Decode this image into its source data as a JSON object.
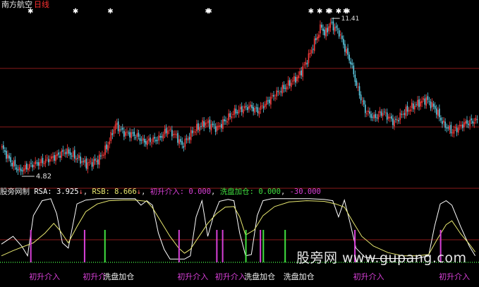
{
  "title": {
    "name": "南方航空",
    "period": "日线"
  },
  "indicator_header": {
    "name": "股旁网制",
    "rsa_label": "RSA:",
    "rsa_value": "3.925",
    "rsb_label": "RSB:",
    "rsb_value": "8.666",
    "chusheng_label": "初升介入:",
    "chusheng_value": "0.000",
    "xipan_label": "洗盘加仓:",
    "xipan_value": "0.000",
    "extra_value": "-30.000"
  },
  "watermark": "股旁网 www.gupang.com",
  "colors": {
    "background": "#000000",
    "up": "#ff3c3c",
    "down": "#5fd0e8",
    "rsa": "#ffffff",
    "rsb": "#e8e870",
    "chusheng": "#d840d8",
    "xipan": "#40e040",
    "grid": "#8a1a1a",
    "name": "#e8e8e8"
  },
  "chart_data": [
    {
      "type": "candlestick",
      "title": "南方航空 日线",
      "price_range": [
        4.3,
        12.0
      ],
      "low_annotation": "4.82",
      "high_annotation": "11.41",
      "close_trajectory": [
        {
          "x": 0,
          "close": 5.9
        },
        {
          "x": 6,
          "close": 5.3
        },
        {
          "x": 12,
          "close": 4.9
        },
        {
          "x": 20,
          "close": 5.15
        },
        {
          "x": 28,
          "close": 5.3
        },
        {
          "x": 36,
          "close": 5.5
        },
        {
          "x": 44,
          "close": 5.75
        },
        {
          "x": 52,
          "close": 5.45
        },
        {
          "x": 58,
          "close": 5.2
        },
        {
          "x": 66,
          "close": 5.35
        },
        {
          "x": 72,
          "close": 5.9
        },
        {
          "x": 78,
          "close": 6.9
        },
        {
          "x": 84,
          "close": 6.55
        },
        {
          "x": 92,
          "close": 6.45
        },
        {
          "x": 98,
          "close": 6.15
        },
        {
          "x": 108,
          "close": 6.3
        },
        {
          "x": 114,
          "close": 6.7
        },
        {
          "x": 120,
          "close": 6.4
        },
        {
          "x": 124,
          "close": 6.0
        },
        {
          "x": 132,
          "close": 6.65
        },
        {
          "x": 140,
          "close": 7.0
        },
        {
          "x": 148,
          "close": 6.75
        },
        {
          "x": 160,
          "close": 7.45
        },
        {
          "x": 170,
          "close": 7.7
        },
        {
          "x": 176,
          "close": 7.5
        },
        {
          "x": 186,
          "close": 8.1
        },
        {
          "x": 196,
          "close": 8.6
        },
        {
          "x": 204,
          "close": 9.0
        },
        {
          "x": 210,
          "close": 9.7
        },
        {
          "x": 216,
          "close": 10.6
        },
        {
          "x": 220,
          "close": 11.2
        },
        {
          "x": 222,
          "close": 10.8
        },
        {
          "x": 226,
          "close": 11.3
        },
        {
          "x": 232,
          "close": 10.9
        },
        {
          "x": 236,
          "close": 10.2
        },
        {
          "x": 240,
          "close": 9.6
        },
        {
          "x": 244,
          "close": 8.6
        },
        {
          "x": 250,
          "close": 7.5
        },
        {
          "x": 256,
          "close": 7.2
        },
        {
          "x": 262,
          "close": 7.45
        },
        {
          "x": 270,
          "close": 7.0
        },
        {
          "x": 276,
          "close": 7.4
        },
        {
          "x": 284,
          "close": 7.75
        },
        {
          "x": 292,
          "close": 8.0
        },
        {
          "x": 298,
          "close": 7.6
        },
        {
          "x": 304,
          "close": 6.9
        },
        {
          "x": 310,
          "close": 6.6
        },
        {
          "x": 318,
          "close": 6.95
        },
        {
          "x": 327,
          "close": 7.1
        }
      ],
      "signal_markers": [
        20,
        51,
        75,
        142,
        143,
        213,
        219,
        225,
        226,
        232,
        237,
        238
      ]
    },
    {
      "type": "line",
      "title": "股旁网制",
      "ylim": [
        0,
        100
      ],
      "series": [
        {
          "name": "RSA",
          "points": [
            [
              0,
              28
            ],
            [
              8,
              40
            ],
            [
              14,
              25
            ],
            [
              18,
              10
            ],
            [
              22,
              72
            ],
            [
              28,
              95
            ],
            [
              34,
              98
            ],
            [
              38,
              75
            ],
            [
              42,
              30
            ],
            [
              46,
              22
            ],
            [
              52,
              90
            ],
            [
              58,
              96
            ],
            [
              66,
              98
            ],
            [
              74,
              98
            ],
            [
              84,
              98
            ],
            [
              92,
              98
            ],
            [
              96,
              88
            ],
            [
              100,
              95
            ],
            [
              104,
              88
            ],
            [
              108,
              45
            ],
            [
              112,
              20
            ],
            [
              116,
              5
            ],
            [
              120,
              5
            ],
            [
              126,
              5
            ],
            [
              130,
              10
            ],
            [
              134,
              70
            ],
            [
              138,
              95
            ],
            [
              142,
              40
            ],
            [
              146,
              72
            ],
            [
              150,
              94
            ],
            [
              156,
              97
            ],
            [
              160,
              95
            ],
            [
              164,
              45
            ],
            [
              168,
              10
            ],
            [
              172,
              12
            ],
            [
              176,
              72
            ],
            [
              180,
              95
            ],
            [
              186,
              98
            ],
            [
              194,
              98
            ],
            [
              202,
              98
            ],
            [
              212,
              98
            ],
            [
              222,
              97
            ],
            [
              228,
              95
            ],
            [
              232,
              70
            ],
            [
              236,
              96
            ],
            [
              240,
              60
            ],
            [
              244,
              22
            ],
            [
              250,
              8
            ],
            [
              256,
              6
            ],
            [
              266,
              6
            ],
            [
              276,
              6
            ],
            [
              286,
              6
            ],
            [
              294,
              10
            ],
            [
              298,
              55
            ],
            [
              302,
              90
            ],
            [
              306,
              95
            ],
            [
              310,
              88
            ],
            [
              316,
              55
            ],
            [
              322,
              25
            ],
            [
              326,
              10
            ]
          ]
        },
        {
          "name": "RSB",
          "points": [
            [
              0,
              10
            ],
            [
              8,
              18
            ],
            [
              16,
              25
            ],
            [
              22,
              30
            ],
            [
              30,
              45
            ],
            [
              36,
              60
            ],
            [
              40,
              50
            ],
            [
              46,
              30
            ],
            [
              52,
              55
            ],
            [
              58,
              78
            ],
            [
              66,
              90
            ],
            [
              74,
              95
            ],
            [
              84,
              96
            ],
            [
              92,
              96
            ],
            [
              100,
              94
            ],
            [
              104,
              84
            ],
            [
              110,
              62
            ],
            [
              116,
              40
            ],
            [
              122,
              22
            ],
            [
              126,
              14
            ],
            [
              130,
              20
            ],
            [
              136,
              40
            ],
            [
              142,
              60
            ],
            [
              148,
              75
            ],
            [
              154,
              85
            ],
            [
              160,
              86
            ],
            [
              164,
              70
            ],
            [
              168,
              42
            ],
            [
              174,
              50
            ],
            [
              180,
              72
            ],
            [
              188,
              86
            ],
            [
              198,
              93
            ],
            [
              210,
              95
            ],
            [
              222,
              94
            ],
            [
              230,
              90
            ],
            [
              236,
              85
            ],
            [
              242,
              62
            ],
            [
              248,
              40
            ],
            [
              256,
              25
            ],
            [
              266,
              15
            ],
            [
              276,
              10
            ],
            [
              286,
              10
            ],
            [
              294,
              12
            ],
            [
              300,
              36
            ],
            [
              306,
              58
            ],
            [
              310,
              64
            ],
            [
              316,
              44
            ],
            [
              322,
              28
            ],
            [
              326,
              16
            ]
          ]
        }
      ],
      "chusheng_signals": [
        20,
        57,
        122,
        148,
        152,
        178,
        243,
        302,
        332
      ],
      "xipan_signals": [
        71,
        168,
        180,
        195
      ],
      "bottom_labels": [
        {
          "text": "初升介入",
          "color": "#d840d8",
          "x": 20
        },
        {
          "text": "初升介",
          "color": "#d840d8",
          "x": 57
        },
        {
          "text": "洗盘加仓",
          "color": "#f0f0f0",
          "x": 71
        },
        {
          "text": "初升介入",
          "color": "#d840d8",
          "x": 122
        },
        {
          "text": "初升介入",
          "color": "#d840d8",
          "x": 148
        },
        {
          "text": "洗盘加仓",
          "color": "#f0f0f0",
          "x": 168
        },
        {
          "text": "洗盘加仓",
          "color": "#f0f0f0",
          "x": 195
        },
        {
          "text": "初升介入",
          "color": "#d840d8",
          "x": 243
        },
        {
          "text": "初升介入",
          "color": "#d840d8",
          "x": 302
        },
        {
          "text": "初",
          "color": "#d840d8",
          "x": 332
        }
      ]
    }
  ]
}
